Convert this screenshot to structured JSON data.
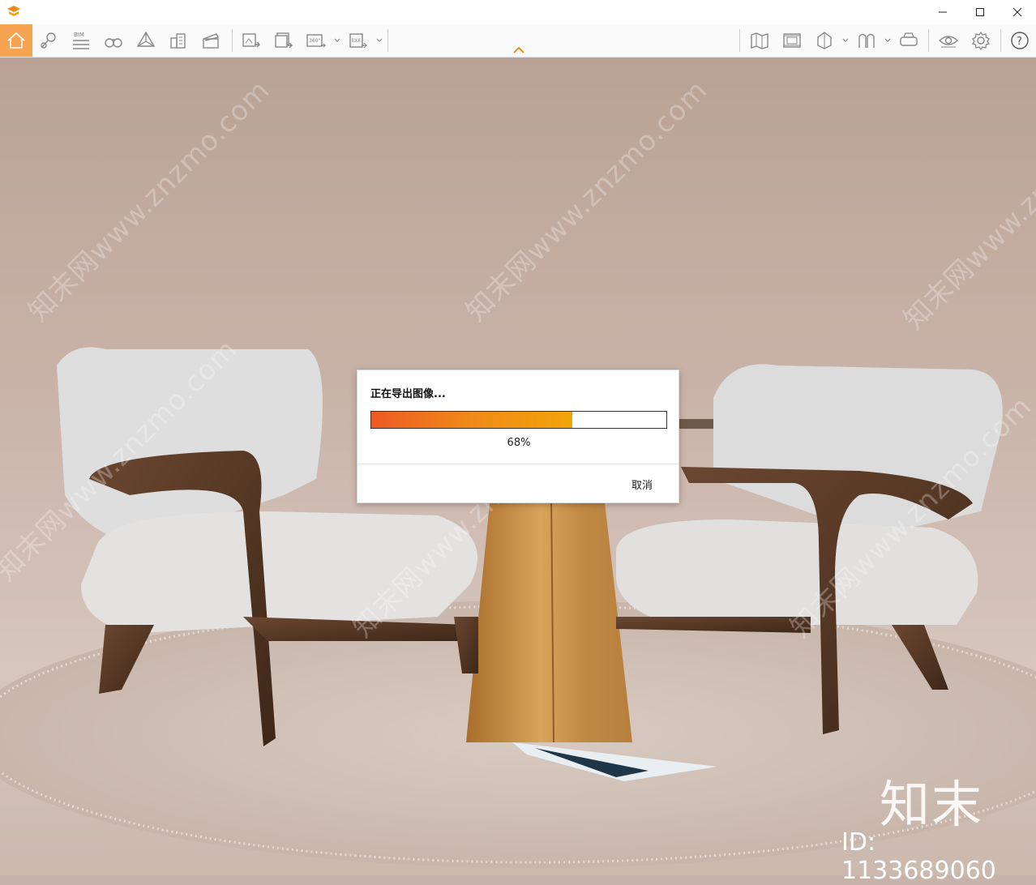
{
  "window": {
    "controls": [
      "minimize",
      "maximize",
      "close"
    ]
  },
  "toolbar": {
    "left_tools": [
      {
        "name": "home-icon",
        "active": true
      },
      {
        "name": "map-pin-icon"
      },
      {
        "name": "bim-icon",
        "label": "BIM"
      },
      {
        "name": "binoculars-icon"
      },
      {
        "name": "perspective-cube-icon"
      },
      {
        "name": "buildings-icon"
      },
      {
        "name": "clapperboard-icon"
      }
    ],
    "export_tools": [
      {
        "name": "export-image-icon"
      },
      {
        "name": "export-batch-icon"
      },
      {
        "name": "export-360-icon",
        "label": "360°",
        "dropdown": true
      },
      {
        "name": "export-exe-icon",
        "label": "EXE",
        "dropdown": true
      }
    ],
    "right_tools": [
      {
        "name": "map-icon"
      },
      {
        "name": "film-strip-icon"
      },
      {
        "name": "section-box-icon",
        "dropdown": true
      },
      {
        "name": "arches-icon",
        "dropdown": true
      },
      {
        "name": "vr-headset-icon"
      },
      {
        "name": "eye-icon"
      },
      {
        "name": "gear-icon"
      },
      {
        "name": "help-icon",
        "label": "?"
      }
    ],
    "accent_color": "#f7a452"
  },
  "dialog": {
    "title": "正在导出图像...",
    "progress_fraction": 0.68,
    "progress_text": "68%",
    "cancel_label": "取消"
  },
  "overlay": {
    "watermark_text": "知末网www.znzmo.com",
    "brand_logo": "知末",
    "id_text": "ID: 1133689060"
  }
}
